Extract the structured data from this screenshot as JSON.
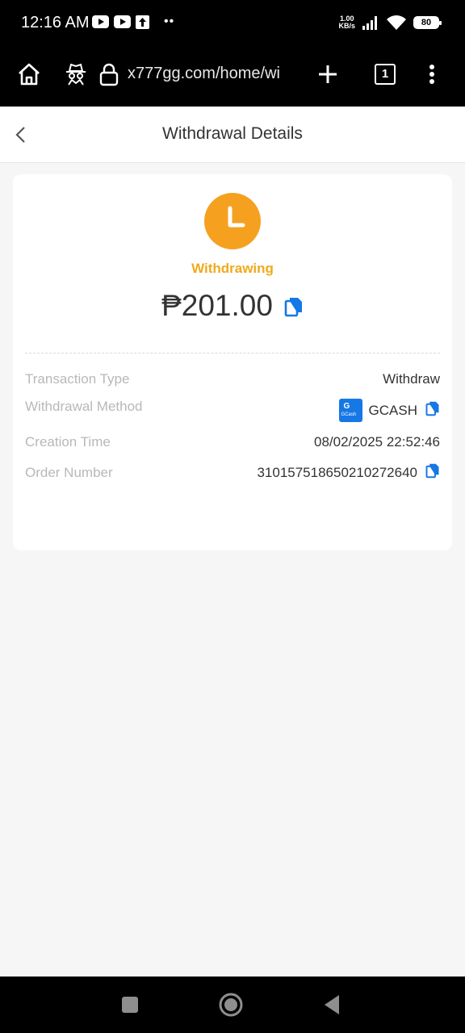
{
  "status_bar": {
    "time": "12:16 AM",
    "net_speed_value": "1.00",
    "net_speed_unit": "KB/s",
    "battery": "80"
  },
  "browser": {
    "url": "x777gg.com/home/wi",
    "tab_count": "1"
  },
  "header": {
    "title": "Withdrawal Details"
  },
  "card": {
    "status_label": "Withdrawing",
    "status_color": "#efaa1c",
    "amount": "₱201.00",
    "details": {
      "transaction_type_label": "Transaction Type",
      "transaction_type_value": "Withdraw",
      "method_label": "Withdrawal Method",
      "method_logo_text": "G",
      "method_logo_sub": "GCash",
      "method_value": "GCASH",
      "creation_label": "Creation Time",
      "creation_value": "08/02/2025 22:52:46",
      "order_label": "Order Number",
      "order_value": "310157518650210272640"
    }
  },
  "colors": {
    "accent_copy": "#1677e6",
    "clock_bg": "#f5a11f"
  }
}
